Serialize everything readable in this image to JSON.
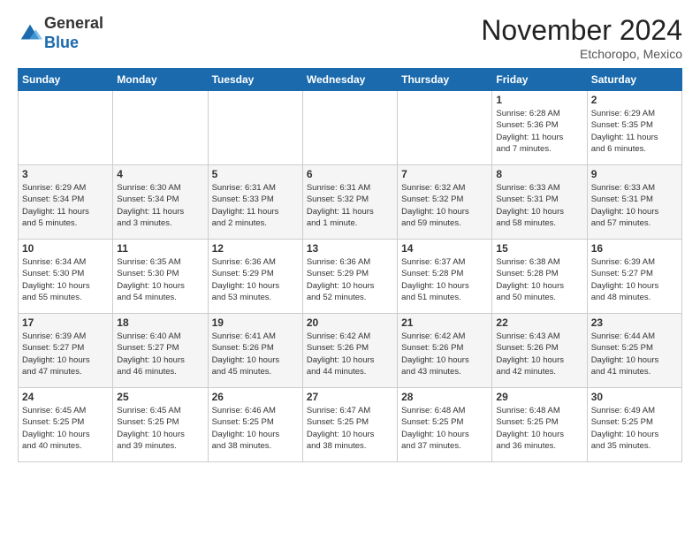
{
  "header": {
    "logo_general": "General",
    "logo_blue": "Blue",
    "month_title": "November 2024",
    "location": "Etchoropo, Mexico"
  },
  "weekdays": [
    "Sunday",
    "Monday",
    "Tuesday",
    "Wednesday",
    "Thursday",
    "Friday",
    "Saturday"
  ],
  "weeks": [
    [
      {
        "day": "",
        "info": ""
      },
      {
        "day": "",
        "info": ""
      },
      {
        "day": "",
        "info": ""
      },
      {
        "day": "",
        "info": ""
      },
      {
        "day": "",
        "info": ""
      },
      {
        "day": "1",
        "info": "Sunrise: 6:28 AM\nSunset: 5:36 PM\nDaylight: 11 hours\nand 7 minutes."
      },
      {
        "day": "2",
        "info": "Sunrise: 6:29 AM\nSunset: 5:35 PM\nDaylight: 11 hours\nand 6 minutes."
      }
    ],
    [
      {
        "day": "3",
        "info": "Sunrise: 6:29 AM\nSunset: 5:34 PM\nDaylight: 11 hours\nand 5 minutes."
      },
      {
        "day": "4",
        "info": "Sunrise: 6:30 AM\nSunset: 5:34 PM\nDaylight: 11 hours\nand 3 minutes."
      },
      {
        "day": "5",
        "info": "Sunrise: 6:31 AM\nSunset: 5:33 PM\nDaylight: 11 hours\nand 2 minutes."
      },
      {
        "day": "6",
        "info": "Sunrise: 6:31 AM\nSunset: 5:32 PM\nDaylight: 11 hours\nand 1 minute."
      },
      {
        "day": "7",
        "info": "Sunrise: 6:32 AM\nSunset: 5:32 PM\nDaylight: 10 hours\nand 59 minutes."
      },
      {
        "day": "8",
        "info": "Sunrise: 6:33 AM\nSunset: 5:31 PM\nDaylight: 10 hours\nand 58 minutes."
      },
      {
        "day": "9",
        "info": "Sunrise: 6:33 AM\nSunset: 5:31 PM\nDaylight: 10 hours\nand 57 minutes."
      }
    ],
    [
      {
        "day": "10",
        "info": "Sunrise: 6:34 AM\nSunset: 5:30 PM\nDaylight: 10 hours\nand 55 minutes."
      },
      {
        "day": "11",
        "info": "Sunrise: 6:35 AM\nSunset: 5:30 PM\nDaylight: 10 hours\nand 54 minutes."
      },
      {
        "day": "12",
        "info": "Sunrise: 6:36 AM\nSunset: 5:29 PM\nDaylight: 10 hours\nand 53 minutes."
      },
      {
        "day": "13",
        "info": "Sunrise: 6:36 AM\nSunset: 5:29 PM\nDaylight: 10 hours\nand 52 minutes."
      },
      {
        "day": "14",
        "info": "Sunrise: 6:37 AM\nSunset: 5:28 PM\nDaylight: 10 hours\nand 51 minutes."
      },
      {
        "day": "15",
        "info": "Sunrise: 6:38 AM\nSunset: 5:28 PM\nDaylight: 10 hours\nand 50 minutes."
      },
      {
        "day": "16",
        "info": "Sunrise: 6:39 AM\nSunset: 5:27 PM\nDaylight: 10 hours\nand 48 minutes."
      }
    ],
    [
      {
        "day": "17",
        "info": "Sunrise: 6:39 AM\nSunset: 5:27 PM\nDaylight: 10 hours\nand 47 minutes."
      },
      {
        "day": "18",
        "info": "Sunrise: 6:40 AM\nSunset: 5:27 PM\nDaylight: 10 hours\nand 46 minutes."
      },
      {
        "day": "19",
        "info": "Sunrise: 6:41 AM\nSunset: 5:26 PM\nDaylight: 10 hours\nand 45 minutes."
      },
      {
        "day": "20",
        "info": "Sunrise: 6:42 AM\nSunset: 5:26 PM\nDaylight: 10 hours\nand 44 minutes."
      },
      {
        "day": "21",
        "info": "Sunrise: 6:42 AM\nSunset: 5:26 PM\nDaylight: 10 hours\nand 43 minutes."
      },
      {
        "day": "22",
        "info": "Sunrise: 6:43 AM\nSunset: 5:26 PM\nDaylight: 10 hours\nand 42 minutes."
      },
      {
        "day": "23",
        "info": "Sunrise: 6:44 AM\nSunset: 5:25 PM\nDaylight: 10 hours\nand 41 minutes."
      }
    ],
    [
      {
        "day": "24",
        "info": "Sunrise: 6:45 AM\nSunset: 5:25 PM\nDaylight: 10 hours\nand 40 minutes."
      },
      {
        "day": "25",
        "info": "Sunrise: 6:45 AM\nSunset: 5:25 PM\nDaylight: 10 hours\nand 39 minutes."
      },
      {
        "day": "26",
        "info": "Sunrise: 6:46 AM\nSunset: 5:25 PM\nDaylight: 10 hours\nand 38 minutes."
      },
      {
        "day": "27",
        "info": "Sunrise: 6:47 AM\nSunset: 5:25 PM\nDaylight: 10 hours\nand 38 minutes."
      },
      {
        "day": "28",
        "info": "Sunrise: 6:48 AM\nSunset: 5:25 PM\nDaylight: 10 hours\nand 37 minutes."
      },
      {
        "day": "29",
        "info": "Sunrise: 6:48 AM\nSunset: 5:25 PM\nDaylight: 10 hours\nand 36 minutes."
      },
      {
        "day": "30",
        "info": "Sunrise: 6:49 AM\nSunset: 5:25 PM\nDaylight: 10 hours\nand 35 minutes."
      }
    ]
  ]
}
